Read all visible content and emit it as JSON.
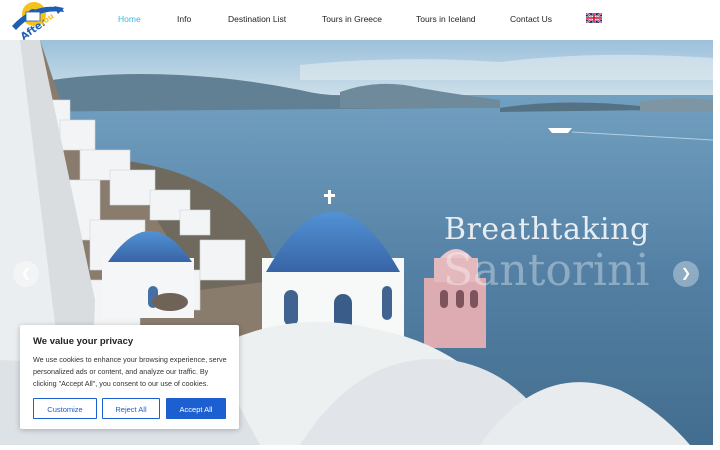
{
  "logo": {
    "text": "AfterYou",
    "icon": "afteryou-logo"
  },
  "nav": {
    "items": [
      {
        "label": "Home",
        "active": true
      },
      {
        "label": "Info",
        "active": false
      },
      {
        "label": "Destination List",
        "active": false
      },
      {
        "label": "Tours in Greece",
        "active": false
      },
      {
        "label": "Tours in Iceland",
        "active": false
      },
      {
        "label": "Contact Us",
        "active": false
      }
    ],
    "language_flag": "uk-flag-icon",
    "active_color": "#3fb7d9"
  },
  "hero": {
    "title": "Breathtaking",
    "subtitle": "Santorini",
    "prev_icon": "chevron-left-icon",
    "next_icon": "chevron-right-icon"
  },
  "cookie": {
    "title": "We value your privacy",
    "text": "We use cookies to enhance your browsing experience, serve personalized ads or content, and analyze our traffic. By clicking \"Accept All\", you consent to our use of cookies.",
    "customize": "Customize",
    "reject": "Reject All",
    "accept": "Accept All",
    "accent_color": "#1b5fd0"
  }
}
